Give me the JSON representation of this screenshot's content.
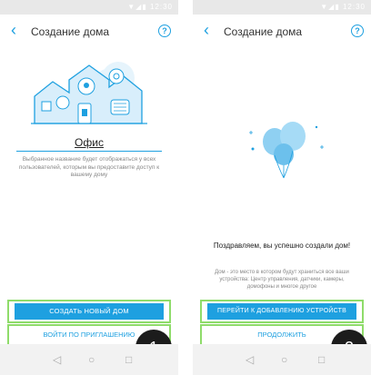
{
  "screen1": {
    "title": "Создание дома",
    "home_name": "Офис",
    "caption": "Выбранное название будет отображаться у всех пользователей, которым вы предоставите доступ к вашему дому",
    "create_button": "СОЗДАТЬ НОВЫЙ ДОМ",
    "invite_button": "ВОЙТИ ПО ПРИГЛАШЕНИЮ",
    "step_badge": "1"
  },
  "screen2": {
    "title": "Создание дома",
    "congrats": "Поздравляем, вы успешно создали дом!",
    "caption": "Дом - это место в котором будут храниться все ваши устройства: Центр управления, датчики, камеры, домофоны и многое другое",
    "add_devices_button": "ПЕРЕЙТИ К ДОБАВЛЕНИЮ УСТРОЙСТВ",
    "continue_button": "ПРОДОЛЖИТЬ",
    "step_badge": "2"
  },
  "status": {
    "time": "12:30"
  },
  "icons": [
    "back-arrow-icon",
    "help-icon",
    "house-illustration",
    "balloons-illustration",
    "nav-back-icon",
    "nav-home-icon",
    "nav-recents-icon",
    "wifi-icon",
    "signal-icon",
    "battery-icon"
  ],
  "colors": {
    "accent": "#1ea0e0",
    "highlight": "#8fdc6a",
    "badge": "#1c1c1c"
  }
}
